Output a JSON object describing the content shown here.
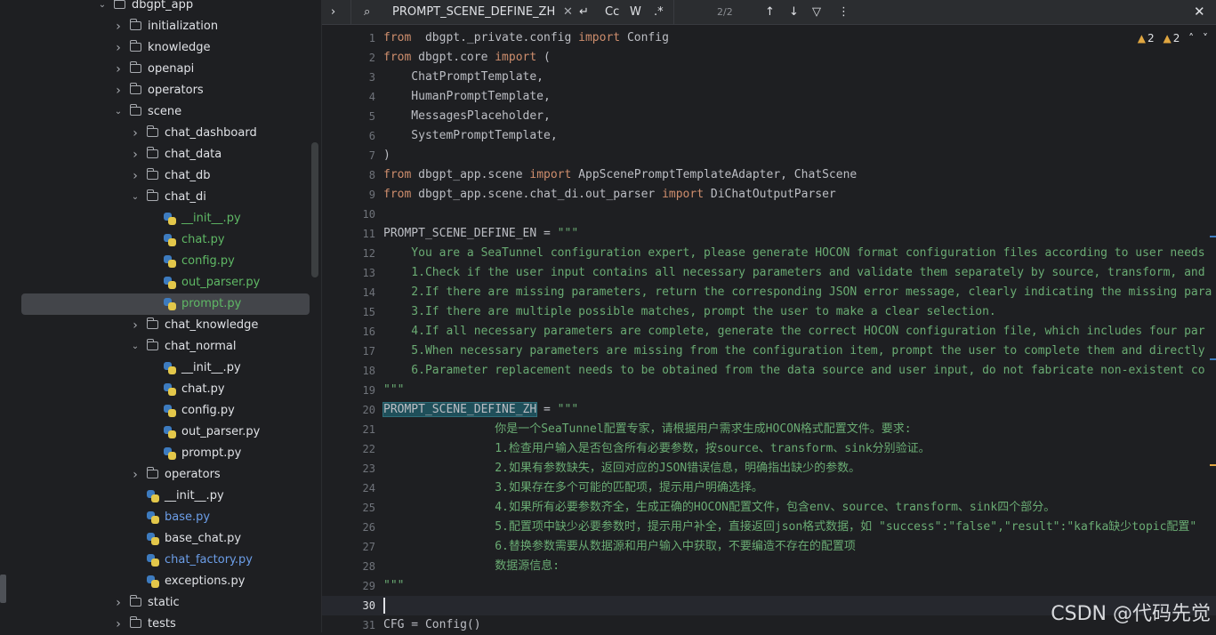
{
  "project_tree": {
    "items": [
      {
        "label": "dbgpt_app",
        "type": "folder",
        "depth": 0,
        "expanded": true
      },
      {
        "label": "initialization",
        "type": "folder",
        "depth": 1,
        "expanded": false
      },
      {
        "label": "knowledge",
        "type": "folder",
        "depth": 1,
        "expanded": false
      },
      {
        "label": "openapi",
        "type": "folder",
        "depth": 1,
        "expanded": false
      },
      {
        "label": "operators",
        "type": "folder",
        "depth": 1,
        "expanded": false
      },
      {
        "label": "scene",
        "type": "folder",
        "depth": 1,
        "expanded": true
      },
      {
        "label": "chat_dashboard",
        "type": "folder",
        "depth": 2,
        "expanded": false
      },
      {
        "label": "chat_data",
        "type": "folder",
        "depth": 2,
        "expanded": false
      },
      {
        "label": "chat_db",
        "type": "folder",
        "depth": 2,
        "expanded": false
      },
      {
        "label": "chat_di",
        "type": "folder",
        "depth": 2,
        "expanded": true
      },
      {
        "label": "__init__.py",
        "type": "py",
        "depth": 3,
        "color": "green"
      },
      {
        "label": "chat.py",
        "type": "py",
        "depth": 3,
        "color": "green"
      },
      {
        "label": "config.py",
        "type": "py",
        "depth": 3,
        "color": "green"
      },
      {
        "label": "out_parser.py",
        "type": "py",
        "depth": 3,
        "color": "green"
      },
      {
        "label": "prompt.py",
        "type": "py",
        "depth": 3,
        "color": "green",
        "selected": true
      },
      {
        "label": "chat_knowledge",
        "type": "folder",
        "depth": 2,
        "expanded": false
      },
      {
        "label": "chat_normal",
        "type": "folder",
        "depth": 2,
        "expanded": true
      },
      {
        "label": "__init__.py",
        "type": "py",
        "depth": 3
      },
      {
        "label": "chat.py",
        "type": "py",
        "depth": 3
      },
      {
        "label": "config.py",
        "type": "py",
        "depth": 3
      },
      {
        "label": "out_parser.py",
        "type": "py",
        "depth": 3
      },
      {
        "label": "prompt.py",
        "type": "py",
        "depth": 3
      },
      {
        "label": "operators",
        "type": "folder",
        "depth": 2,
        "expanded": false
      },
      {
        "label": "__init__.py",
        "type": "py",
        "depth": 2
      },
      {
        "label": "base.py",
        "type": "py",
        "depth": 2,
        "color": "blue"
      },
      {
        "label": "base_chat.py",
        "type": "py",
        "depth": 2
      },
      {
        "label": "chat_factory.py",
        "type": "py",
        "depth": 2,
        "color": "blue"
      },
      {
        "label": "exceptions.py",
        "type": "py",
        "depth": 2
      },
      {
        "label": "static",
        "type": "folder",
        "depth": 1,
        "expanded": false
      },
      {
        "label": "tests",
        "type": "folder",
        "depth": 1,
        "expanded": false
      }
    ]
  },
  "find_bar": {
    "query": "PROMPT_SCENE_DEFINE_ZH",
    "match_case": "Cc",
    "whole_word": "W",
    "regex": ".*",
    "count": "2/2"
  },
  "inspections": {
    "warnings_a": "2",
    "warnings_b": "2"
  },
  "editor": {
    "current_line": "30",
    "lines": [
      {
        "n": "1",
        "segs": [
          [
            "kw",
            "from"
          ],
          [
            "",
            "  dbgpt._private.config "
          ],
          [
            "kw",
            "import"
          ],
          [
            "",
            " Config"
          ]
        ]
      },
      {
        "n": "2",
        "segs": [
          [
            "kw",
            "from"
          ],
          [
            "",
            " dbgpt.core "
          ],
          [
            "kw",
            "import"
          ],
          [
            "",
            " ("
          ]
        ]
      },
      {
        "n": "3",
        "segs": [
          [
            "",
            "    ChatPromptTemplate,"
          ]
        ]
      },
      {
        "n": "4",
        "segs": [
          [
            "",
            "    HumanPromptTemplate,"
          ]
        ]
      },
      {
        "n": "5",
        "segs": [
          [
            "",
            "    MessagesPlaceholder,"
          ]
        ]
      },
      {
        "n": "6",
        "segs": [
          [
            "",
            "    SystemPromptTemplate,"
          ]
        ]
      },
      {
        "n": "7",
        "segs": [
          [
            "",
            ")"
          ]
        ]
      },
      {
        "n": "8",
        "segs": [
          [
            "kw",
            "from"
          ],
          [
            "",
            " dbgpt_app.scene "
          ],
          [
            "kw",
            "import"
          ],
          [
            "",
            " AppScenePromptTemplateAdapter, ChatScene"
          ]
        ]
      },
      {
        "n": "9",
        "segs": [
          [
            "kw",
            "from"
          ],
          [
            "",
            " dbgpt_app.scene.chat_di.out_parser "
          ],
          [
            "kw",
            "import"
          ],
          [
            "",
            " DiChatOutputParser"
          ]
        ]
      },
      {
        "n": "10",
        "segs": []
      },
      {
        "n": "11",
        "segs": [
          [
            "",
            "PROMPT_SCENE_DEFINE_EN = "
          ],
          [
            "st",
            "\"\"\""
          ]
        ]
      },
      {
        "n": "12",
        "segs": [
          [
            "st",
            "    You are a SeaTunnel configuration expert, please generate HOCON format configuration files according to user needs"
          ]
        ]
      },
      {
        "n": "13",
        "segs": [
          [
            "st",
            "    1.Check if the user input contains all necessary parameters and validate them separately by source, transform, and"
          ]
        ]
      },
      {
        "n": "14",
        "segs": [
          [
            "st",
            "    2.If there are missing parameters, return the corresponding JSON error message, clearly indicating the missing para"
          ]
        ]
      },
      {
        "n": "15",
        "segs": [
          [
            "st",
            "    3.If there are multiple possible matches, prompt the user to make a clear selection."
          ]
        ]
      },
      {
        "n": "16",
        "segs": [
          [
            "st",
            "    4.If all necessary parameters are complete, generate the correct HOCON configuration file, which includes four par"
          ]
        ]
      },
      {
        "n": "17",
        "segs": [
          [
            "st",
            "    5.When necessary parameters are missing from the configuration item, prompt the user to complete them and directly"
          ]
        ]
      },
      {
        "n": "18",
        "segs": [
          [
            "st",
            "    6.Parameter replacement needs to be obtained from the data source and user input, do not fabricate non-existent co"
          ]
        ]
      },
      {
        "n": "19",
        "segs": [
          [
            "st",
            "\"\"\""
          ]
        ]
      },
      {
        "n": "20",
        "segs": [
          [
            "hl",
            "PROMPT_SCENE_DEFINE_ZH"
          ],
          [
            "",
            " = "
          ],
          [
            "st",
            "\"\"\""
          ]
        ]
      },
      {
        "n": "21",
        "segs": [
          [
            "st",
            "                你是一个SeaTunnel配置专家，请根据用户需求生成HOCON格式配置文件。要求:"
          ]
        ]
      },
      {
        "n": "22",
        "segs": [
          [
            "st",
            "                1.检查用户输入是否包含所有必要参数，按source、transform、sink分别验证。"
          ]
        ]
      },
      {
        "n": "23",
        "segs": [
          [
            "st",
            "                2.如果有参数缺失，返回对应的JSON错误信息，明确指出缺少的参数。"
          ]
        ]
      },
      {
        "n": "24",
        "segs": [
          [
            "st",
            "                3.如果存在多个可能的匹配项，提示用户明确选择。"
          ]
        ]
      },
      {
        "n": "25",
        "segs": [
          [
            "st",
            "                4.如果所有必要参数齐全，生成正确的HOCON配置文件，包含env、source、transform、sink四个部分。"
          ]
        ]
      },
      {
        "n": "26",
        "segs": [
          [
            "st",
            "                5.配置项中缺少必要参数时，提示用户补全，直接返回json格式数据，如 \"success\":\"false\",\"result\":\"kafka缺少topic配置\""
          ]
        ]
      },
      {
        "n": "27",
        "segs": [
          [
            "st",
            "                6.替换参数需要从数据源和用户输入中获取，不要编造不存在的配置项"
          ]
        ]
      },
      {
        "n": "28",
        "segs": [
          [
            "st",
            "                数据源信息:"
          ]
        ]
      },
      {
        "n": "29",
        "segs": [
          [
            "st",
            "\"\"\""
          ]
        ]
      },
      {
        "n": "30",
        "segs": []
      },
      {
        "n": "31",
        "segs": [
          [
            "",
            "CFG = Config()"
          ]
        ]
      }
    ]
  },
  "watermark": "CSDN @代码先觉"
}
